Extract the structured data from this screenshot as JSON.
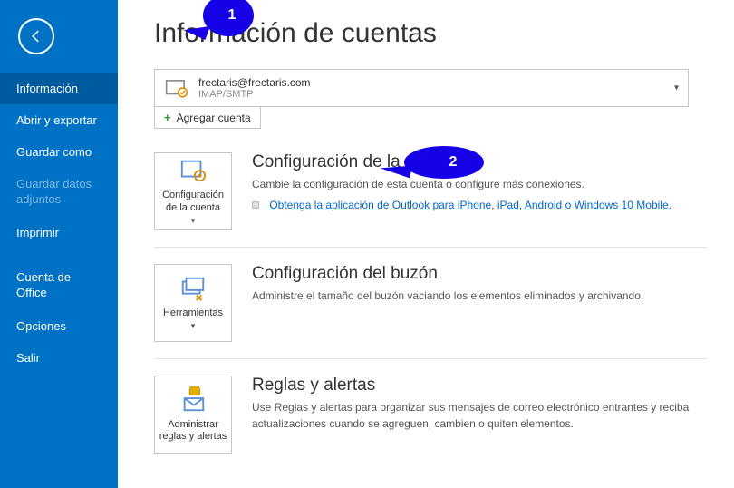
{
  "sidebar": {
    "items": [
      {
        "label": "Información",
        "state": "active"
      },
      {
        "label": "Abrir y exportar",
        "state": "normal"
      },
      {
        "label": "Guardar como",
        "state": "normal"
      },
      {
        "label": "Guardar datos adjuntos",
        "state": "disabled"
      },
      {
        "label": "Imprimir",
        "state": "normal"
      },
      {
        "label": "Cuenta de Office",
        "state": "normal"
      },
      {
        "label": "Opciones",
        "state": "normal"
      },
      {
        "label": "Salir",
        "state": "normal"
      }
    ]
  },
  "page_title": "Información de cuentas",
  "account": {
    "email": "frectaris@frectaris.com",
    "protocol": "IMAP/SMTP"
  },
  "add_account_label": "Agregar cuenta",
  "sections": [
    {
      "tile_label": "Configuración de la cuenta",
      "tile_has_caret": true,
      "title": "Configuración de la cuenta",
      "desc": "Cambie la configuración de esta cuenta o configure más conexiones.",
      "link": "Obtenga la aplicación de Outlook para iPhone, iPad, Android o Windows 10 Mobile."
    },
    {
      "tile_label": "Herramientas",
      "tile_has_caret": true,
      "title": "Configuración del buzón",
      "desc": "Administre el tamaño del buzón vaciando los elementos eliminados y archivando."
    },
    {
      "tile_label": "Administrar reglas y alertas",
      "tile_has_caret": false,
      "title": "Reglas y alertas",
      "desc": "Use Reglas y alertas para organizar sus mensajes de correo electrónico entrantes y reciba actualizaciones cuando se agreguen, cambien o quiten elementos."
    }
  ],
  "callouts": {
    "c1": "1",
    "c2": "2"
  }
}
